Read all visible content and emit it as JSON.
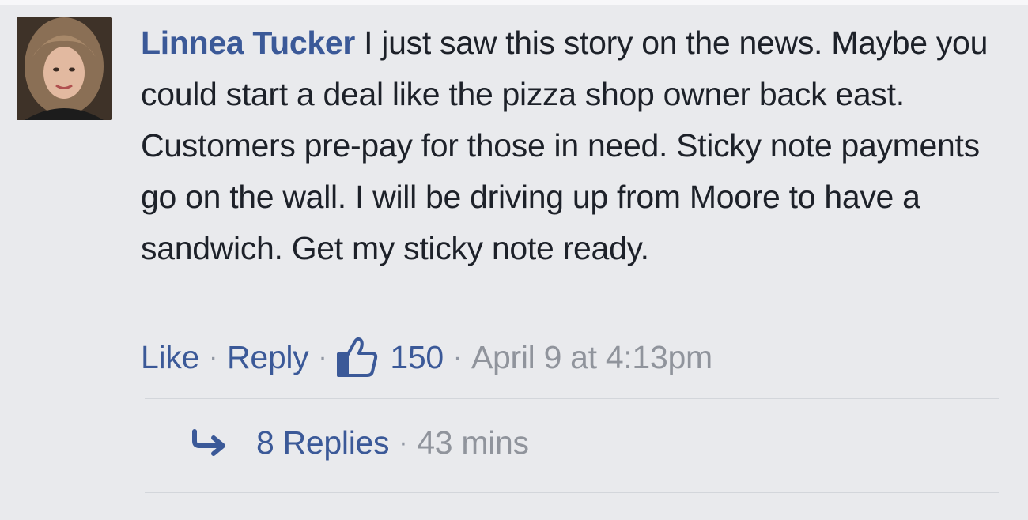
{
  "comment": {
    "author": "Linnea Tucker",
    "text": " I just saw this story on the news. Maybe you could start a deal like the pizza shop owner back east. Customers pre-pay for those in need. Sticky note payments go on the wall. I will be driving up from Moore to have a sandwich. Get my sticky note ready.",
    "like_label": "Like",
    "reply_label": "Reply",
    "like_count": "150",
    "timestamp": "April 9 at 4:13pm",
    "separator": "·"
  },
  "replies": {
    "label": "8 Replies",
    "separator": "·",
    "time": "43 mins"
  },
  "colors": {
    "link": "#3b5998",
    "text": "#1d2129",
    "meta": "#90949c",
    "background": "#e9eaed"
  },
  "icons": {
    "like": "thumbs-up-icon",
    "reply": "reply-arrow-icon",
    "avatar": "avatar"
  }
}
